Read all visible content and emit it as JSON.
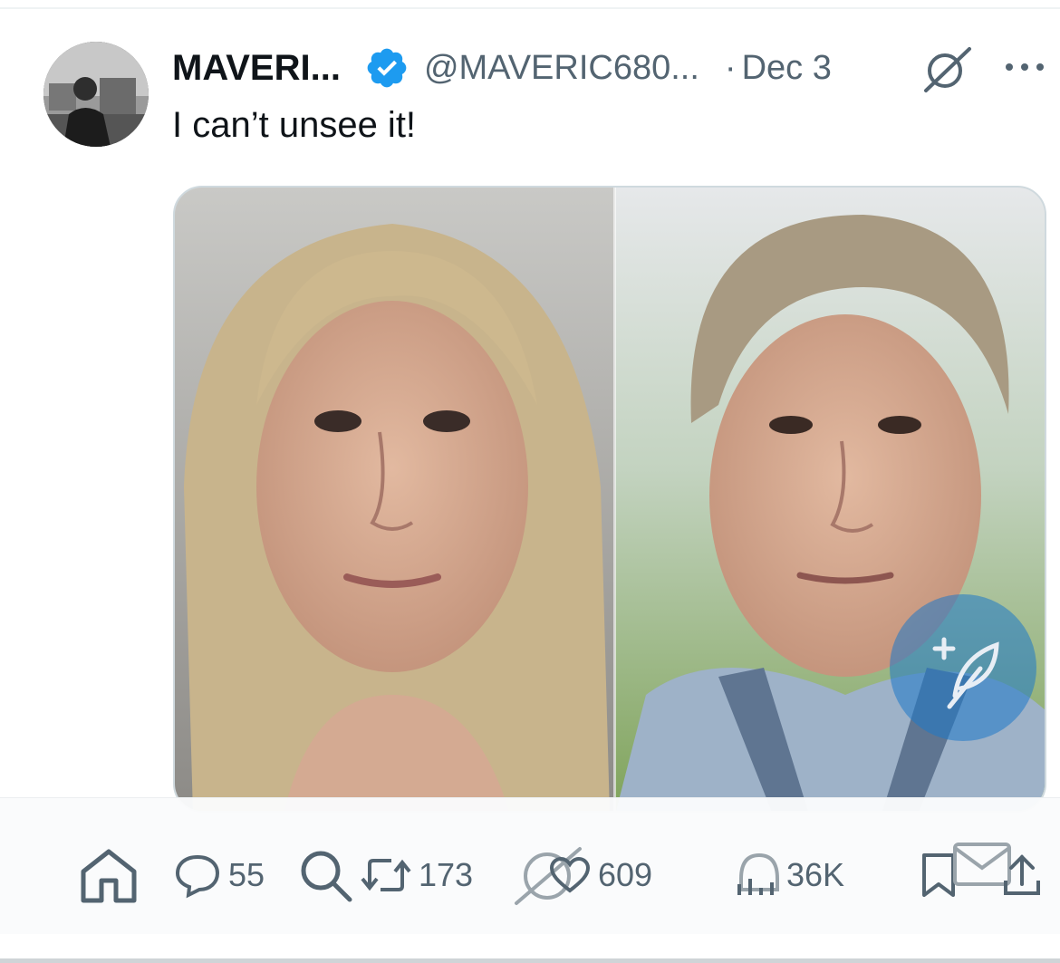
{
  "tweet": {
    "author_name": "MAVERI...",
    "handle": "@MAVERIC680...",
    "separator": "·",
    "date": "Dec 3",
    "text": "I can’t unsee it!"
  },
  "metrics": {
    "replies": "55",
    "retweets": "173",
    "likes": "609",
    "views": "36K"
  },
  "icons": {
    "verified": "verified-badge-icon",
    "grok": "grok-icon",
    "more": "more-icon",
    "home": "home-icon",
    "reply": "reply-icon",
    "search": "search-icon",
    "retweet": "retweet-icon",
    "like": "heart-icon",
    "views": "views-icon",
    "bookmark": "bookmark-icon",
    "messages": "envelope-icon",
    "share": "share-icon",
    "compose": "compose-feather-icon"
  },
  "colors": {
    "verified_blue": "#1d9bf0",
    "secondary_text": "#536471",
    "primary_text": "#0f1419",
    "fab_blue": "#1d78c8"
  }
}
